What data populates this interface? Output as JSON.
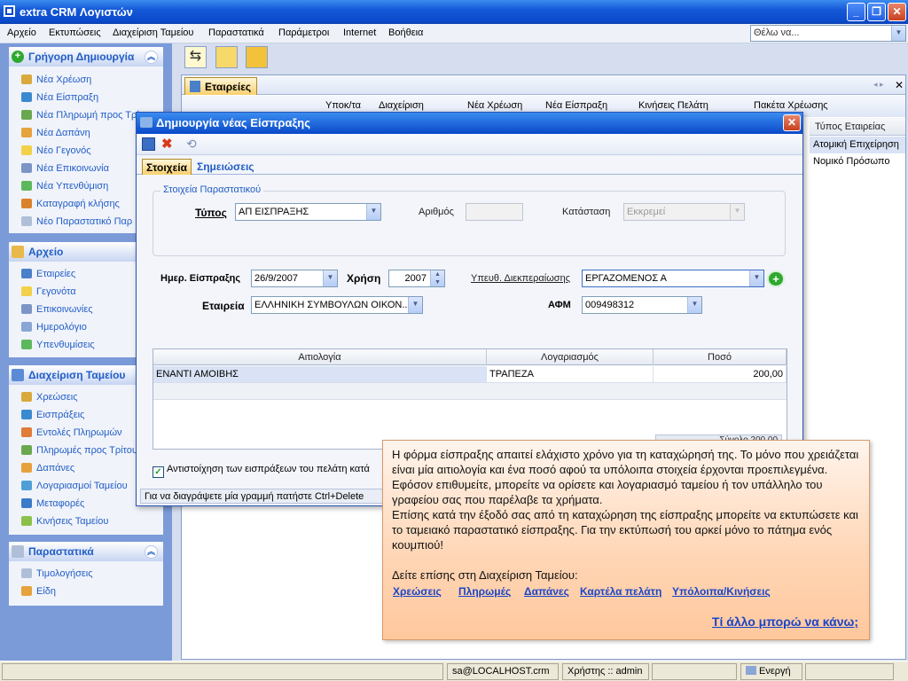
{
  "app": {
    "title": "extra CRM Λογιστών"
  },
  "menu": [
    "Αρχείο",
    "Εκτυπώσεις",
    "Διαχείριση Ταμείου",
    "Παραστατικά",
    "Παράμετροι",
    "Internet",
    "Βοήθεια"
  ],
  "search": {
    "value": "Θέλω να..."
  },
  "left": {
    "quick": {
      "title": "Γρήγορη Δημιουργία",
      "items": [
        "Νέα Χρέωση",
        "Νέα Είσπραξη",
        "Νέα Πληρωμή προς Τρί",
        "Νέα Δαπάνη",
        "Νέο Γεγονός",
        "Νέα Επικοινωνία",
        "Νέα Υπενθύμιση",
        "Καταγραφή κλήσης",
        "Νέο Παραστατικό Παρ"
      ]
    },
    "archive": {
      "title": "Αρχείο",
      "items": [
        "Εταιρείες",
        "Γεγονότα",
        "Επικοινωνίες",
        "Ημερολόγιο",
        "Υπενθυμίσεις"
      ]
    },
    "cash": {
      "title": "Διαχείριση Ταμείου",
      "items": [
        "Χρεώσεις",
        "Εισπράξεις",
        "Εντολές Πληρωμών",
        "Πληρωμές προς Τρίτου",
        "Δαπάνες",
        "Λογαριασμοί Ταμείου",
        "Μεταφορές",
        "Κινήσεις Ταμείου"
      ]
    },
    "docs": {
      "title": "Παραστατικά",
      "items": [
        "Τιμολογήσεις",
        "Είδη"
      ]
    }
  },
  "doc": {
    "tab": "Εταιρείες",
    "toolbar": [
      "Υποκ/τα",
      "Διαχείριση",
      "Νέα Χρέωση",
      "Νέα Είσπραξη",
      "Κινήσεις Πελάτη",
      "Πακέτα Χρέωσης"
    ],
    "side": {
      "header": "Τύπος Εταιρείας",
      "rows": [
        "Ατομική Επιχείρηση",
        "Νομικό Πρόσωπο"
      ]
    }
  },
  "dialog": {
    "title": "Δημιουργία νέας Είσπραξης",
    "tabs": [
      "Στοιχεία",
      "Σημειώσεις"
    ],
    "legend": "Στοιχεία Παραστατικού",
    "type_label": "Τύπος",
    "type_value": "ΑΠ ΕΙΣΠΡΑΞΗΣ",
    "number_label": "Αριθμός",
    "number_value": "",
    "status_label": "Κατάσταση",
    "status_value": "Εκκρεμεί",
    "date_label": "Ημερ. Είσπραξης",
    "date_value": "26/9/2007",
    "year_label": "Χρήση",
    "year_value": "2007",
    "resp_label": "Υπευθ. Διεκπεραίωσης",
    "resp_value": "ΕΡΓΑΖΟΜΕΝΟΣ Α",
    "company_label": "Εταιρεία",
    "company_value": "ΕΛΛΗΝΙΚΗ ΣΥΜΒΟΥΛΩΝ ΟΙΚΟΝ...",
    "afm_label": "ΑΦΜ",
    "afm_value": "009498312",
    "grid": {
      "headers": [
        "Αιτιολογία",
        "Λογαριασμός",
        "Ποσό"
      ],
      "row": {
        "reason": "ΕΝΑΝΤΙ ΑΜΟΙΒΗΣ",
        "account": "ΤΡΑΠΕΖΑ",
        "amount": "200,00"
      },
      "total": "Σύνολο 200,00"
    },
    "checkbox": "Αντιστοίχηση των εισπράξεων του πελάτη κατά",
    "status": "Για να διαγράψετε μία γραμμή πατήστε Ctrl+Delete"
  },
  "tip": {
    "p1": "Η φόρμα είσπραξης απαιτεί ελάχιστο χρόνο για τη καταχώρησή της. Το μόνο που χρειάζεται είναι μία αιτιολογία και ένα ποσό αφού τα υπόλοιπα στοιχεία έρχονται προεπιλεγμένα. Εφόσον επιθυμείτε, μπορείτε να ορίσετε και λογαριασμό ταμείου ή τον υπάλληλο του γραφείου σας που παρέλαβε τα χρήματα.",
    "p2": "Επίσης κατά την έξοδό σας από τη καταχώρηση της είσπραξης μπορείτε να εκτυπώσετε και το ταμειακό παραστατικό είσπραξης. Για την εκτύπωσή του αρκεί μόνο το πάτημα ενός κουμπιού!",
    "see": "Δείτε επίσης στη Διαχείριση Ταμείου:",
    "links": [
      "Χρεώσεις",
      "Πληρωμές",
      "Δαπάνες",
      "Καρτέλα πελάτη",
      "Υπόλοιπα/Κινήσεις"
    ],
    "more": "Τί άλλο μπορώ να κάνω;"
  },
  "status": {
    "server": "sa@LOCALHOST.crm",
    "user": "Χρήστης :: admin",
    "state": "Ενεργή"
  }
}
